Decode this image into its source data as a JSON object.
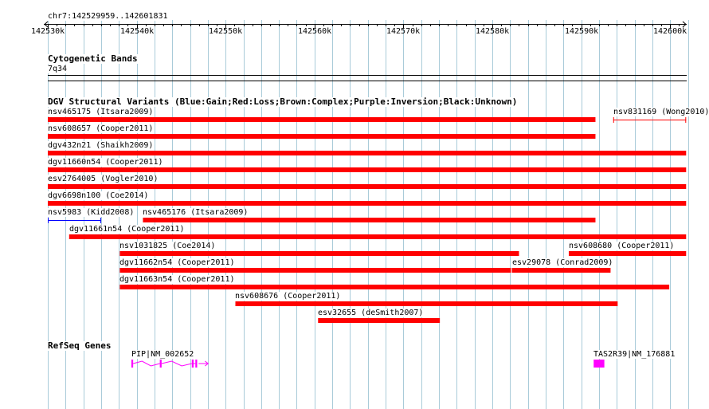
{
  "locus": "chr7:142529959..142601831",
  "colors": {
    "grid": "#a9cbd9",
    "gain": "#0000ff",
    "loss": "#ff0000",
    "complex": "#8b4513",
    "inversion": "#800080",
    "unknown": "#000000",
    "gene": "#ff00ff"
  },
  "ruler": {
    "ticks": [
      "142530k",
      "142540k",
      "142550k",
      "142560k",
      "142570k",
      "142580k",
      "142590k",
      "142600k"
    ]
  },
  "cytoband": {
    "title": "Cytogenetic Bands",
    "band": "7q34"
  },
  "dgv": {
    "title": "DGV Structural Variants (Blue:Gain;Red:Loss;Brown:Complex;Purple:Inversion;Black:Unknown)",
    "variants": [
      {
        "label": "nsv465175 (Itsara2009)",
        "type": "loss",
        "style": "bar",
        "start_kb": 142530.0,
        "end_kb": 142591.6
      },
      {
        "label": "nsv831169 (Wong2010)",
        "type": "loss",
        "style": "line",
        "start_kb": 142593.6,
        "end_kb": 142601.8
      },
      {
        "label": "nsv608657 (Cooper2011)",
        "type": "loss",
        "style": "bar",
        "start_kb": 142530.0,
        "end_kb": 142591.6
      },
      {
        "label": "dgv432n21 (Shaikh2009)",
        "type": "loss",
        "style": "bar",
        "start_kb": 142530.0,
        "end_kb": 142601.8
      },
      {
        "label": "dgv11660n54 (Cooper2011)",
        "type": "loss",
        "style": "bar",
        "start_kb": 142530.0,
        "end_kb": 142601.8
      },
      {
        "label": "esv2764005 (Vogler2010)",
        "type": "loss",
        "style": "bar",
        "start_kb": 142530.0,
        "end_kb": 142601.8
      },
      {
        "label": "dgv6698n100 (Coe2014)",
        "type": "loss",
        "style": "bar",
        "start_kb": 142530.0,
        "end_kb": 142601.8
      },
      {
        "label": "nsv5983 (Kidd2008)",
        "type": "gain",
        "style": "line",
        "start_kb": 142530.0,
        "end_kb": 142536.0
      },
      {
        "label": "nsv465176 (Itsara2009)",
        "type": "loss",
        "style": "bar",
        "start_kb": 142540.7,
        "end_kb": 142591.6
      },
      {
        "label": "dgv11661n54 (Cooper2011)",
        "type": "loss",
        "style": "bar",
        "start_kb": 142532.4,
        "end_kb": 142601.8
      },
      {
        "label": "nsv1031825 (Coe2014)",
        "type": "loss",
        "style": "bar",
        "start_kb": 142538.1,
        "end_kb": 142583.0
      },
      {
        "label": "nsv608680 (Cooper2011)",
        "type": "loss",
        "style": "bar",
        "start_kb": 142588.6,
        "end_kb": 142601.8
      },
      {
        "label": "dgv11662n54 (Cooper2011)",
        "type": "loss",
        "style": "bar",
        "start_kb": 142538.1,
        "end_kb": 142582.1
      },
      {
        "label": "esv29078 (Conrad2009)",
        "type": "loss",
        "style": "bar",
        "start_kb": 142582.2,
        "end_kb": 142593.3
      },
      {
        "label": "dgv11663n54 (Cooper2011)",
        "type": "loss",
        "style": "bar",
        "start_kb": 142538.1,
        "end_kb": 142599.9
      },
      {
        "label": "nsv608676 (Cooper2011)",
        "type": "loss",
        "style": "bar",
        "start_kb": 142551.1,
        "end_kb": 142594.1
      },
      {
        "label": "esv32655 (deSmith2007)",
        "type": "loss",
        "style": "bar",
        "start_kb": 142560.4,
        "end_kb": 142574.1
      }
    ]
  },
  "refseq": {
    "title": "RefSeq Genes",
    "genes": [
      {
        "label": "PIP|NM_002652",
        "start_kb": 142539.4,
        "end_kb": 142547.5,
        "exons_kb": [
          [
            142539.4,
            142539.6
          ],
          [
            142542.6,
            142542.8
          ],
          [
            142546.2,
            142546.4
          ],
          [
            142546.6,
            142546.8
          ]
        ]
      },
      {
        "label": "TAS2R39|NM_176881",
        "start_kb": 142591.4,
        "end_kb": 142592.6,
        "exons_kb": [
          [
            142591.4,
            142592.6
          ]
        ]
      }
    ]
  }
}
